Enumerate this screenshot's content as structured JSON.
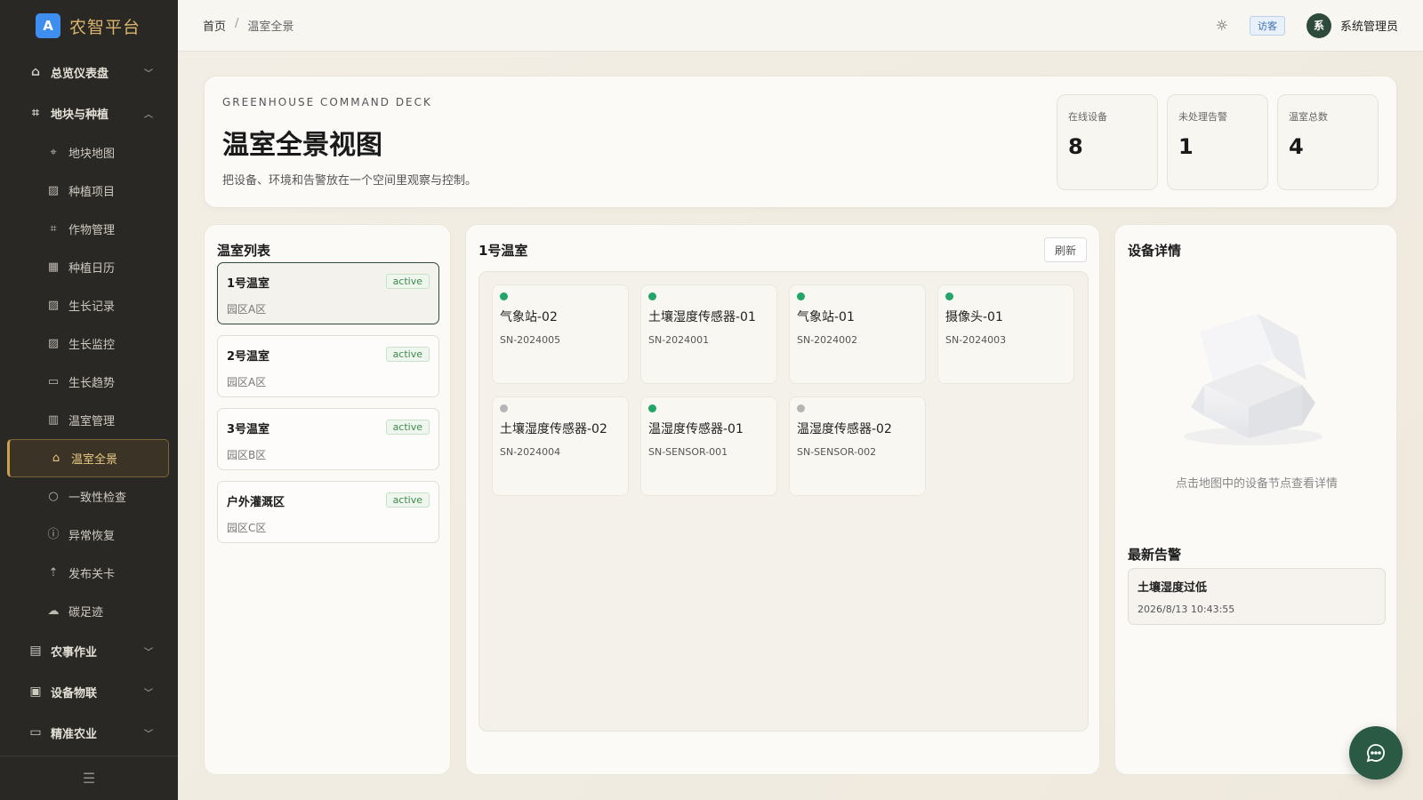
{
  "brand": {
    "logo_letter": "A",
    "title": "农智平台"
  },
  "sidebar": {
    "items": [
      {
        "type": "group",
        "label": "总览仪表盘",
        "icon": "home-icon",
        "expanded": false
      },
      {
        "type": "group",
        "label": "地块与种植",
        "icon": "crop-icon",
        "expanded": true
      },
      {
        "type": "item",
        "label": "地块地图",
        "icon": "map-pin-icon"
      },
      {
        "type": "item",
        "label": "种植项目",
        "icon": "chart-icon"
      },
      {
        "type": "item",
        "label": "作物管理",
        "icon": "crop-icon"
      },
      {
        "type": "item",
        "label": "种植日历",
        "icon": "calendar-icon"
      },
      {
        "type": "item",
        "label": "生长记录",
        "icon": "chart-icon"
      },
      {
        "type": "item",
        "label": "生长监控",
        "icon": "chart-icon"
      },
      {
        "type": "item",
        "label": "生长趋势",
        "icon": "presentation-icon"
      },
      {
        "type": "item",
        "label": "温室管理",
        "icon": "building-icon"
      },
      {
        "type": "item",
        "label": "温室全景",
        "icon": "home-icon",
        "active": true
      },
      {
        "type": "item",
        "label": "一致性检查",
        "icon": "search-icon"
      },
      {
        "type": "item",
        "label": "异常恢复",
        "icon": "alert-circle-icon"
      },
      {
        "type": "item",
        "label": "发布关卡",
        "icon": "upload-icon"
      },
      {
        "type": "item",
        "label": "碳足迹",
        "icon": "cloud-icon"
      },
      {
        "type": "group",
        "label": "农事作业",
        "icon": "briefcase-icon",
        "expanded": false
      },
      {
        "type": "group",
        "label": "设备物联",
        "icon": "chip-icon",
        "expanded": false
      },
      {
        "type": "group",
        "label": "精准农业",
        "icon": "presentation-icon",
        "expanded": false
      }
    ]
  },
  "header": {
    "breadcrumb": [
      "首页",
      "温室全景"
    ],
    "breadcrumb_sep": "/",
    "guest_label": "访客",
    "avatar_letter": "系",
    "user_name": "系统管理员"
  },
  "hero": {
    "eyebrow": "GREENHOUSE COMMAND DECK",
    "title": "温室全景视图",
    "subtitle": "把设备、环境和告警放在一个空间里观察与控制。",
    "stats": [
      {
        "label": "在线设备",
        "value": "8"
      },
      {
        "label": "未处理告警",
        "value": "1"
      },
      {
        "label": "温室总数",
        "value": "4"
      }
    ]
  },
  "greenhouse_list": {
    "title": "温室列表",
    "items": [
      {
        "name": "1号温室",
        "area": "园区A区",
        "status": "active",
        "selected": true
      },
      {
        "name": "2号温室",
        "area": "园区A区",
        "status": "active"
      },
      {
        "name": "3号温室",
        "area": "园区B区",
        "status": "active"
      },
      {
        "name": "户外灌溉区",
        "area": "园区C区",
        "status": "active"
      }
    ]
  },
  "device_panel": {
    "title": "1号温室",
    "refresh_label": "刷新",
    "devices": [
      {
        "name": "气象站-02",
        "sn": "SN-2024005",
        "online": true
      },
      {
        "name": "土壤湿度传感器-01",
        "sn": "SN-2024001",
        "online": true
      },
      {
        "name": "气象站-01",
        "sn": "SN-2024002",
        "online": true
      },
      {
        "name": "摄像头-01",
        "sn": "SN-2024003",
        "online": true
      },
      {
        "name": "土壤湿度传感器-02",
        "sn": "SN-2024004",
        "online": false
      },
      {
        "name": "温湿度传感器-01",
        "sn": "SN-SENSOR-001",
        "online": true
      },
      {
        "name": "温湿度传感器-02",
        "sn": "SN-SENSOR-002",
        "online": false
      }
    ]
  },
  "detail_panel": {
    "title": "设备详情",
    "empty_text": "点击地图中的设备节点查看详情",
    "alerts_title": "最新告警",
    "alerts": [
      {
        "name": "土壤湿度过低",
        "time": "2026/8/13 10:43:55"
      }
    ]
  },
  "colors": {
    "accent": "#c9a24e",
    "online": "#22a566",
    "offline": "#b5b5b5",
    "sidebar_bg": "#2a2824"
  }
}
